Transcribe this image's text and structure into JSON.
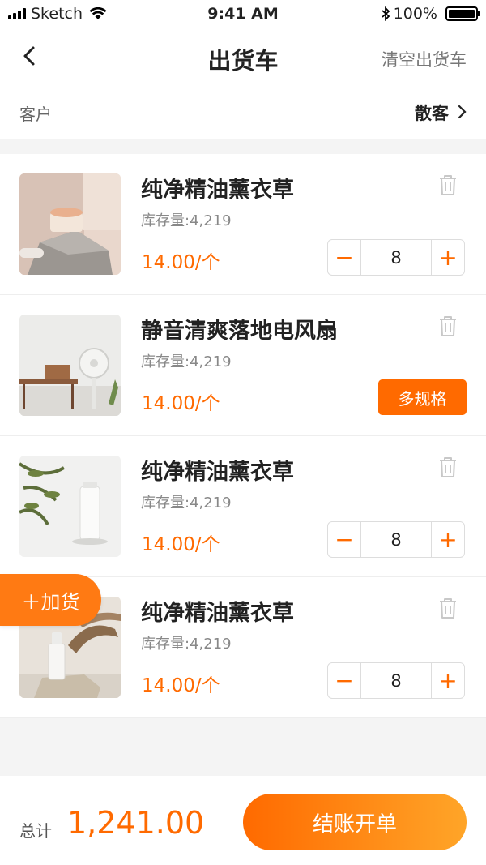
{
  "status_bar": {
    "carrier": "Sketch",
    "time": "9:41 AM",
    "battery": "100%"
  },
  "nav": {
    "title": "出货车",
    "clear_label": "清空出货车"
  },
  "customer": {
    "label": "客户",
    "value": "散客"
  },
  "items": [
    {
      "name": "纯净精油薰衣草",
      "stock": "库存量:4,219",
      "price": "14.00/个",
      "qty": "8",
      "type": "stepper",
      "thumb": "cream-jar-image"
    },
    {
      "name": "静音清爽落地电风扇",
      "stock": "库存量:4,219",
      "price": "14.00/个",
      "spec_label": "多规格",
      "type": "spec",
      "thumb": "floor-fan-image"
    },
    {
      "name": "纯净精油薰衣草",
      "stock": "库存量:4,219",
      "price": "14.00/个",
      "qty": "8",
      "type": "stepper",
      "thumb": "lotion-bottle-image"
    },
    {
      "name": "纯净精油薰衣草",
      "stock": "库存量:4,219",
      "price": "14.00/个",
      "qty": "8",
      "type": "stepper",
      "thumb": "serum-dropper-image"
    }
  ],
  "stepper": {
    "minus": "−",
    "plus": "+"
  },
  "add_goods": "＋加货",
  "footer": {
    "total_label": "总计",
    "total_value": "1,241.00",
    "checkout_label": "结账开单"
  },
  "colors": {
    "accent": "#ff6a00",
    "accent_end": "#ffa528"
  }
}
